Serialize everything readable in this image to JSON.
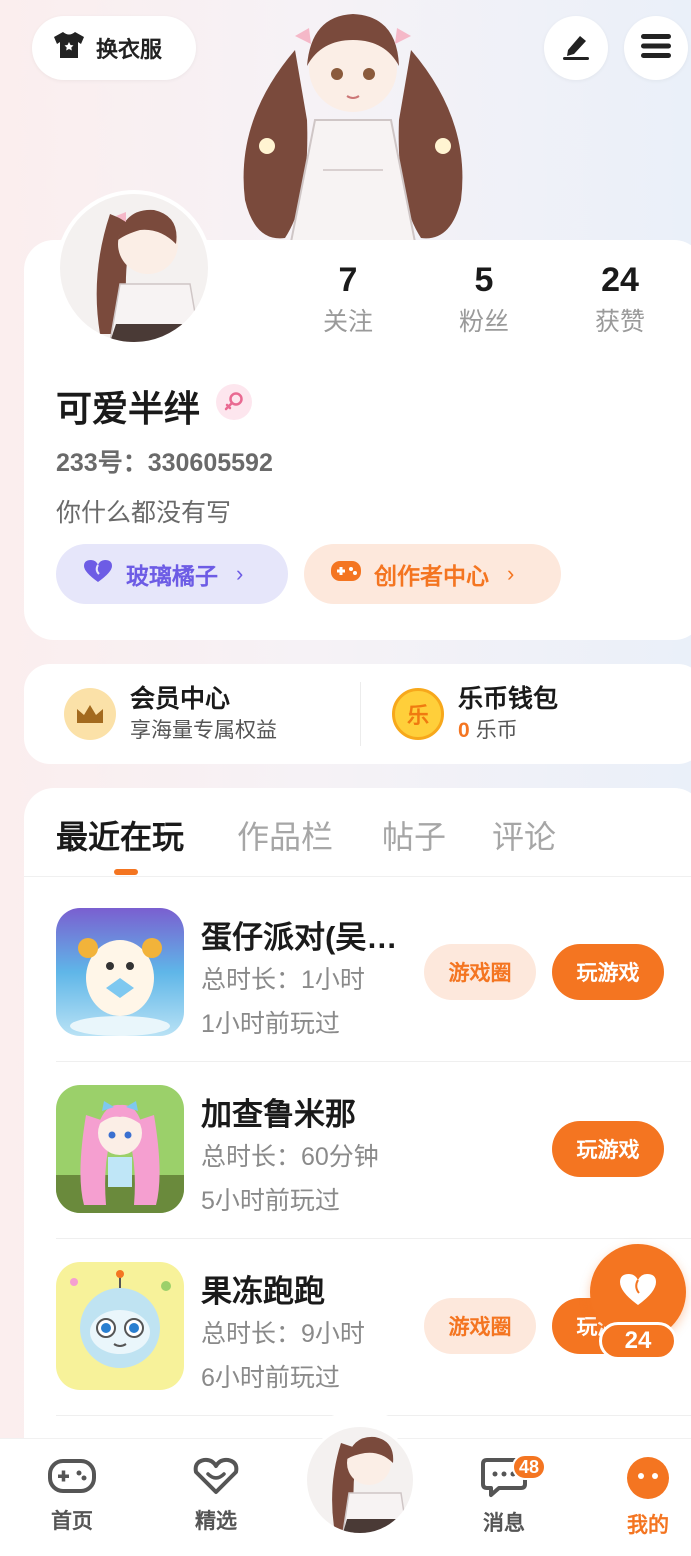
{
  "header": {
    "wardrobe_label": "换衣服",
    "icons": [
      "shirt-icon",
      "pen-icon",
      "menu-icon"
    ]
  },
  "profile": {
    "stats": [
      {
        "value": "7",
        "label": "关注"
      },
      {
        "value": "5",
        "label": "粉丝"
      },
      {
        "value": "24",
        "label": "获赞"
      }
    ],
    "nickname": "可爱半绊",
    "gender": "female",
    "uid": "233号：330605592",
    "bio": "你什么都没有写",
    "pills": [
      {
        "label": "玻璃橘子",
        "icon": "heart-icon"
      },
      {
        "label": "创作者中心",
        "icon": "gamepad-icon"
      }
    ]
  },
  "wallet": {
    "vip_title": "会员中心",
    "vip_sub": "享海量专属权益",
    "coin_title": "乐币钱包",
    "coin_amount": "0",
    "coin_unit": "乐币",
    "coin_glyph": "乐"
  },
  "tabs": [
    {
      "label": "最近在玩",
      "active": true
    },
    {
      "label": "作品栏",
      "active": false
    },
    {
      "label": "帖子",
      "active": false
    },
    {
      "label": "评论",
      "active": false
    }
  ],
  "games": [
    {
      "name": "蛋仔派对(吴…",
      "total": "总时长：1小时",
      "last": "1小时前玩过",
      "circle_label": "游戏圈",
      "play_label": "玩游戏"
    },
    {
      "name": "加查鲁米那",
      "total": "总时长：60分钟",
      "last": "5小时前玩过",
      "play_label": "玩游戏"
    },
    {
      "name": "果冻跑跑",
      "total": "总时长：9小时",
      "last": "6小时前玩过",
      "circle_label": "游戏圈",
      "play_label": "玩游戏"
    }
  ],
  "float_like": {
    "count": "24"
  },
  "nav": {
    "items": [
      {
        "label": "首页",
        "icon": "gamepad-icon"
      },
      {
        "label": "精选",
        "icon": "heart-icon"
      },
      {
        "label": "消息",
        "icon": "chat-icon",
        "badge": "48"
      },
      {
        "label": "我的",
        "icon": "me-icon",
        "active": true
      }
    ]
  },
  "colors": {
    "accent": "#f47521",
    "purple": "#6d5ce5"
  }
}
